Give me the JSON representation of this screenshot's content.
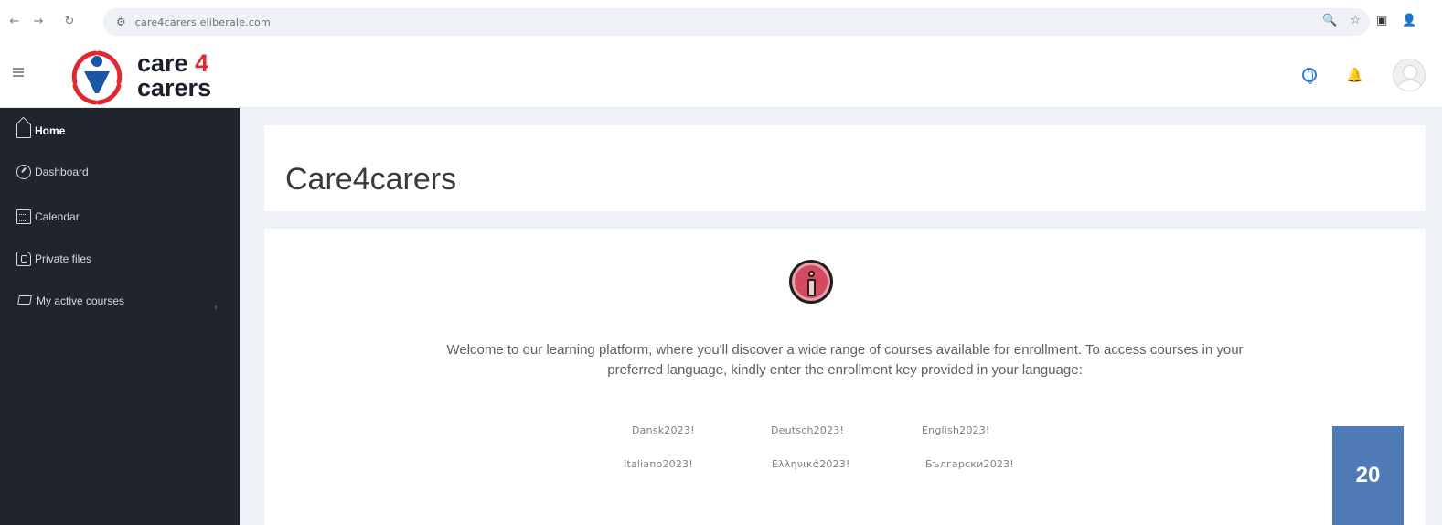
{
  "browser": {
    "back_icon": "←",
    "forward_icon": "→",
    "reload_icon": "↻",
    "site_icon": "⚙",
    "url": "care4carers.eliberale.com",
    "zoom_icon": "🔍",
    "bookmark_icon": "☆",
    "sidepanel_icon": "▣",
    "profile_icon": "👤"
  },
  "app": {
    "logo_care": "care",
    "logo_four": "4",
    "logo_carers": "carers"
  },
  "sidebar": {
    "items": [
      {
        "label": "Home"
      },
      {
        "label": "Dashboard"
      },
      {
        "label": "Calendar"
      },
      {
        "label": "Private files"
      },
      {
        "label": "My active courses"
      }
    ],
    "chevron": "‹"
  },
  "header": {
    "title": "Care4carers"
  },
  "content": {
    "welcome_line1": "Welcome to our learning platform, where you'll discover a wide range of courses available for enrollment. To access courses in your",
    "welcome_line2": "preferred language, kindly enter the enrollment key provided in your language:",
    "keys": [
      "Dansk2023!",
      "Deutsch2023!",
      "English2023!",
      "Italiano2023!",
      "Eλληνικά2023!",
      "Български2023!"
    ]
  },
  "page_number": "20",
  "colors": {
    "sidebar_bg": "#20242c",
    "main_bg": "#eef2f6",
    "accent_red": "#e0292e",
    "badge_blue": "#4f7ab5",
    "info_red": "#d24a5f"
  }
}
